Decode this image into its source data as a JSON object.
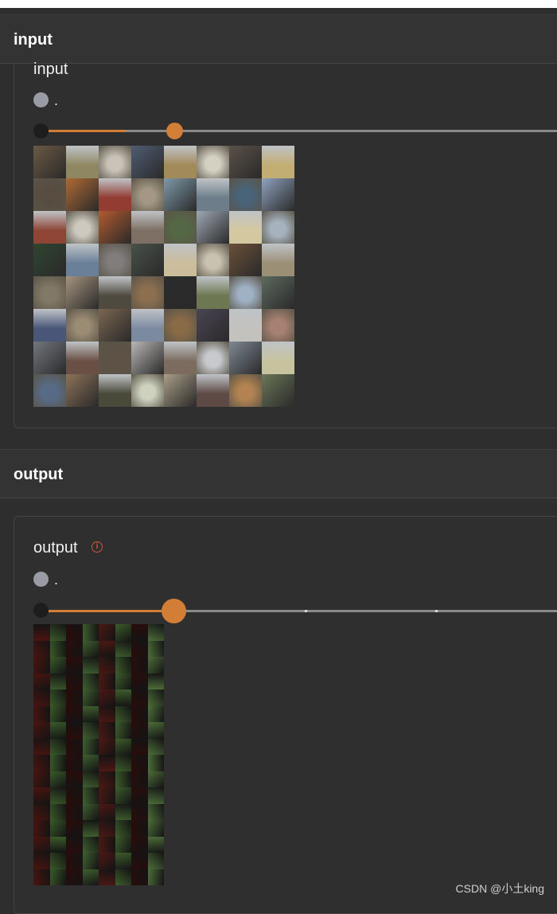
{
  "input_section": {
    "title": "input",
    "card_label": "input",
    "radio_text": ".",
    "slider": {
      "value_fraction": 0.27
    },
    "image": {
      "rows": 8,
      "cols": 8,
      "description_colors": [
        "#6b5a43",
        "#8f8762",
        "#c9c2b7",
        "#4e5d73",
        "#a38a5a",
        "#d4d1c2",
        "#5b5148",
        "#c2ad72",
        "#574c3f",
        "#b06a34",
        "#933c31",
        "#a49884",
        "#7e9aa8",
        "#6d7e8a",
        "#496378",
        "#8fa2bf",
        "#8e4536",
        "#cdc9bf",
        "#b35a2f",
        "#7d6f63",
        "#556845",
        "#9da8b3",
        "#d4c8a0",
        "#a6b3bf",
        "#2f4530",
        "#6a7f98",
        "#807d7c",
        "#48514a",
        "#cbbd9c",
        "#c9c2b0",
        "#6b5039",
        "#9b8f76",
        "#827866",
        "#a5947f",
        "#4f4a3f",
        "#8c6f4f",
        "#2a2b2c",
        "#6d7751",
        "#9fb1c5",
        "#5d6a5e",
        "#4a5678",
        "#9b8c74",
        "#7a6651",
        "#7c8aa0",
        "#8a6b47",
        "#4a4554",
        "#c4c2bd",
        "#a68071",
        "#72777f",
        "#6a4f45",
        "#5d5245",
        "#b8b7b5",
        "#7b6c5f",
        "#c7cacd",
        "#7e8894",
        "#c7c39f",
        "#576b86",
        "#8b7258",
        "#4a4a3a",
        "#cdd1be",
        "#a99d86",
        "#5d4a45",
        "#b38351",
        "#6b7758"
      ]
    }
  },
  "output_section": {
    "title": "output",
    "card_label": "output",
    "info_icon": "info-circle-icon",
    "radio_text": ".",
    "slider": {
      "value_fraction": 0.27,
      "ticks": 3
    },
    "image": {
      "rows": 16,
      "cols": 8,
      "column_colors": [
        "#4a1410",
        "#3a5a2a",
        "#2a0c0a",
        "#3f5f2f",
        "#4c1814",
        "#3d5c2c",
        "#280d0b",
        "#4d6d3a"
      ]
    }
  },
  "watermark": "CSDN @小土king",
  "colors": {
    "accent": "#d27e36",
    "background": "#2e2e2e",
    "info": "#d0543c"
  }
}
